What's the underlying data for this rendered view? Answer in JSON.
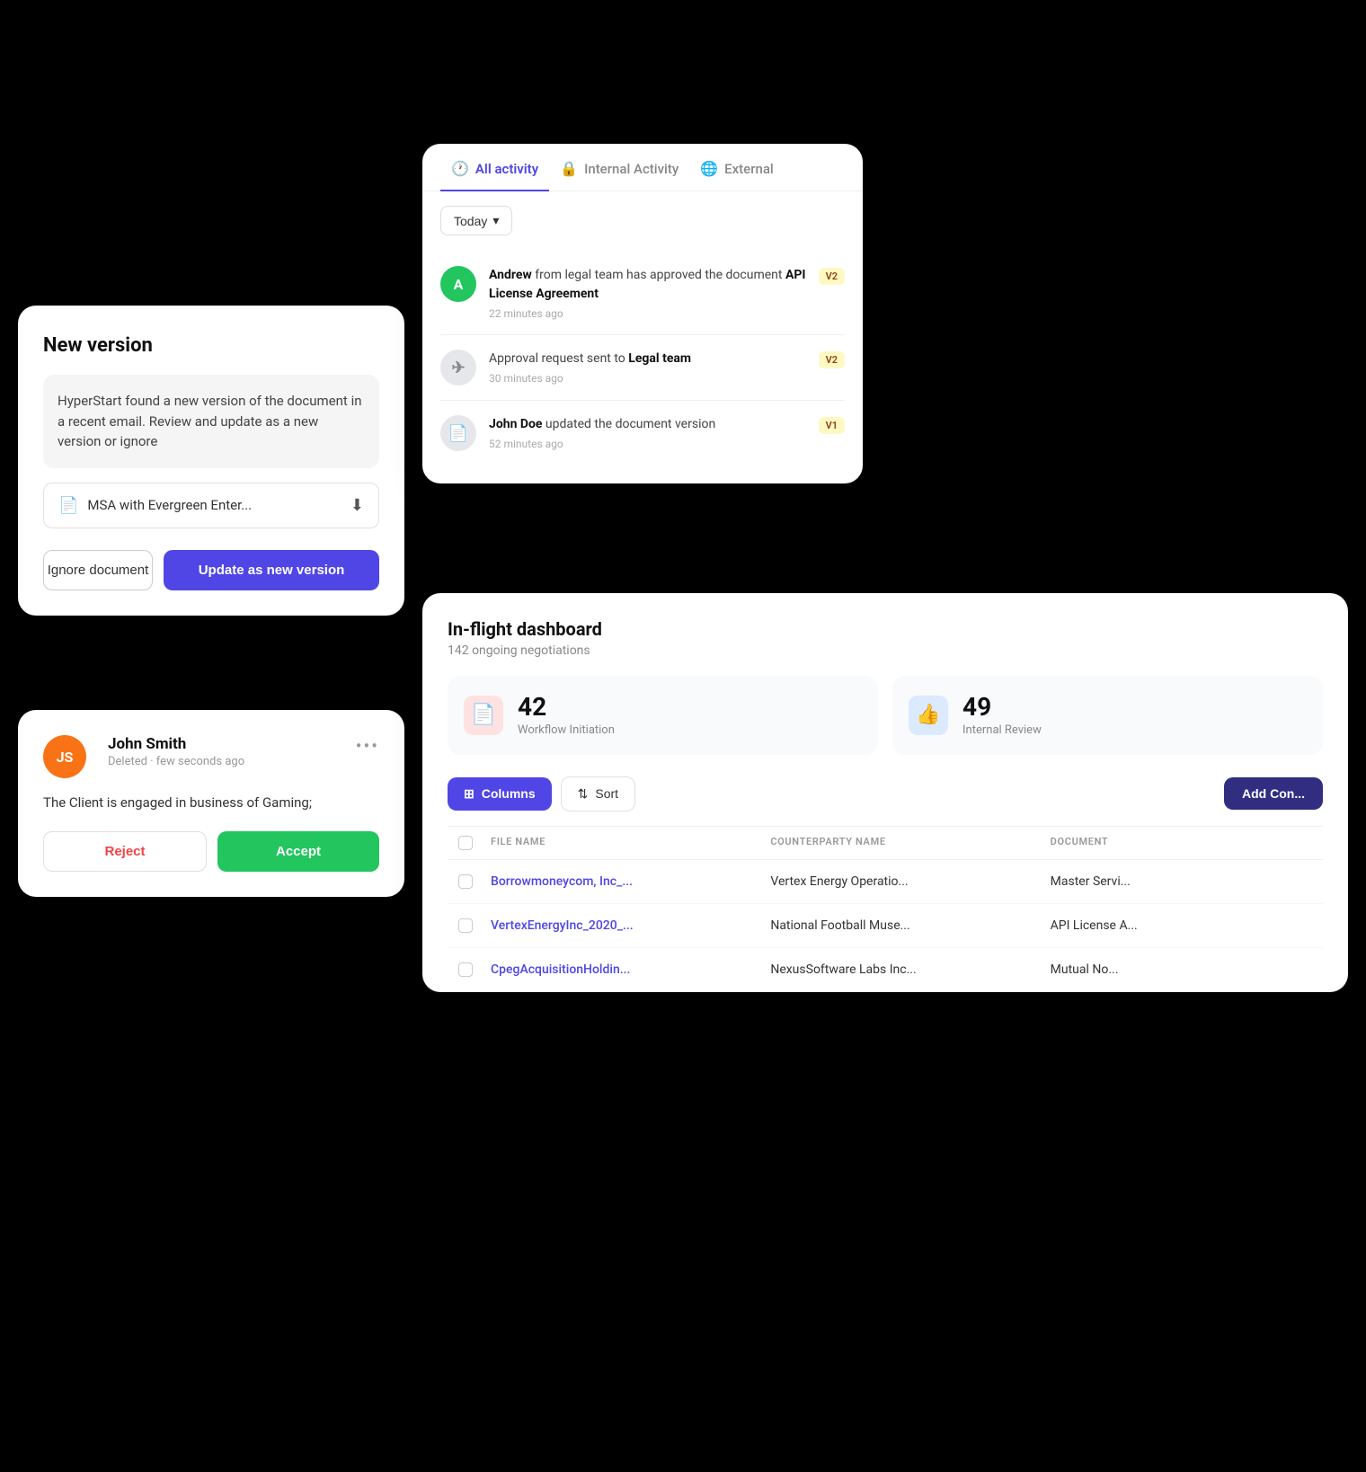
{
  "new_version_card": {
    "title": "New version",
    "description": "HyperStart found a new version of the document in a recent email. Review and update as a new version or ignore",
    "file_name": "MSA with Evergreen Enter...",
    "btn_ignore": "Ignore document",
    "btn_update": "Update as new version"
  },
  "john_smith_card": {
    "initials": "JS",
    "name": "John Smith",
    "meta": "Deleted · few seconds ago",
    "content": "The Client is engaged in business of Gaming;",
    "btn_reject": "Reject",
    "btn_accept": "Accept"
  },
  "activity_panel": {
    "tabs": [
      {
        "label": "All activity",
        "active": true,
        "icon": "🕐"
      },
      {
        "label": "Internal Activity",
        "active": false,
        "icon": "🔒"
      },
      {
        "label": "External",
        "active": false,
        "icon": "🌐"
      }
    ],
    "filter": "Today",
    "items": [
      {
        "avatar_text": "A",
        "avatar_color": "green",
        "text_before": " from legal team has approved the document ",
        "actor": "Andrew",
        "bold_text": "API License Agreement",
        "time": "22 minutes ago",
        "version": "V2",
        "icon_type": "letter"
      },
      {
        "avatar_text": "✈",
        "avatar_color": "gray",
        "text_before": "Approval request sent to ",
        "actor": "",
        "bold_text": "Legal team",
        "time": "30 minutes ago",
        "version": "V2",
        "icon_type": "icon"
      },
      {
        "avatar_text": "📄",
        "avatar_color": "gray",
        "actor": "John Doe",
        "text_before": " updated the document version",
        "bold_text": "",
        "time": "52 minutes ago",
        "version": "V1",
        "icon_type": "icon"
      }
    ]
  },
  "dashboard": {
    "title": "In-flight dashboard",
    "subtitle": "142 ongoing negotiations",
    "stats": [
      {
        "number": "42",
        "label": "Workflow Initiation",
        "icon": "📄",
        "icon_bg": "red"
      },
      {
        "number": "49",
        "label": "Internal Review",
        "icon": "👍",
        "icon_bg": "blue"
      }
    ],
    "toolbar": {
      "columns_btn": "Columns",
      "sort_btn": "Sort",
      "add_btn": "Add Con..."
    },
    "table": {
      "headers": [
        "",
        "FILE NAME",
        "COUNTERPARTY NAME",
        "DOCUMENT"
      ],
      "rows": [
        {
          "file": "Borrowmoneycom, Inc_...",
          "counterparty": "Vertex Energy Operatio...",
          "document": "Master Servi..."
        },
        {
          "file": "VertexEnergyInc_2020_...",
          "counterparty": "National Football Muse...",
          "document": "API License A..."
        },
        {
          "file": "CpegAcquisitionHoldin...",
          "counterparty": "NexusSoftware Labs Inc...",
          "document": "Mutual No..."
        }
      ]
    }
  }
}
